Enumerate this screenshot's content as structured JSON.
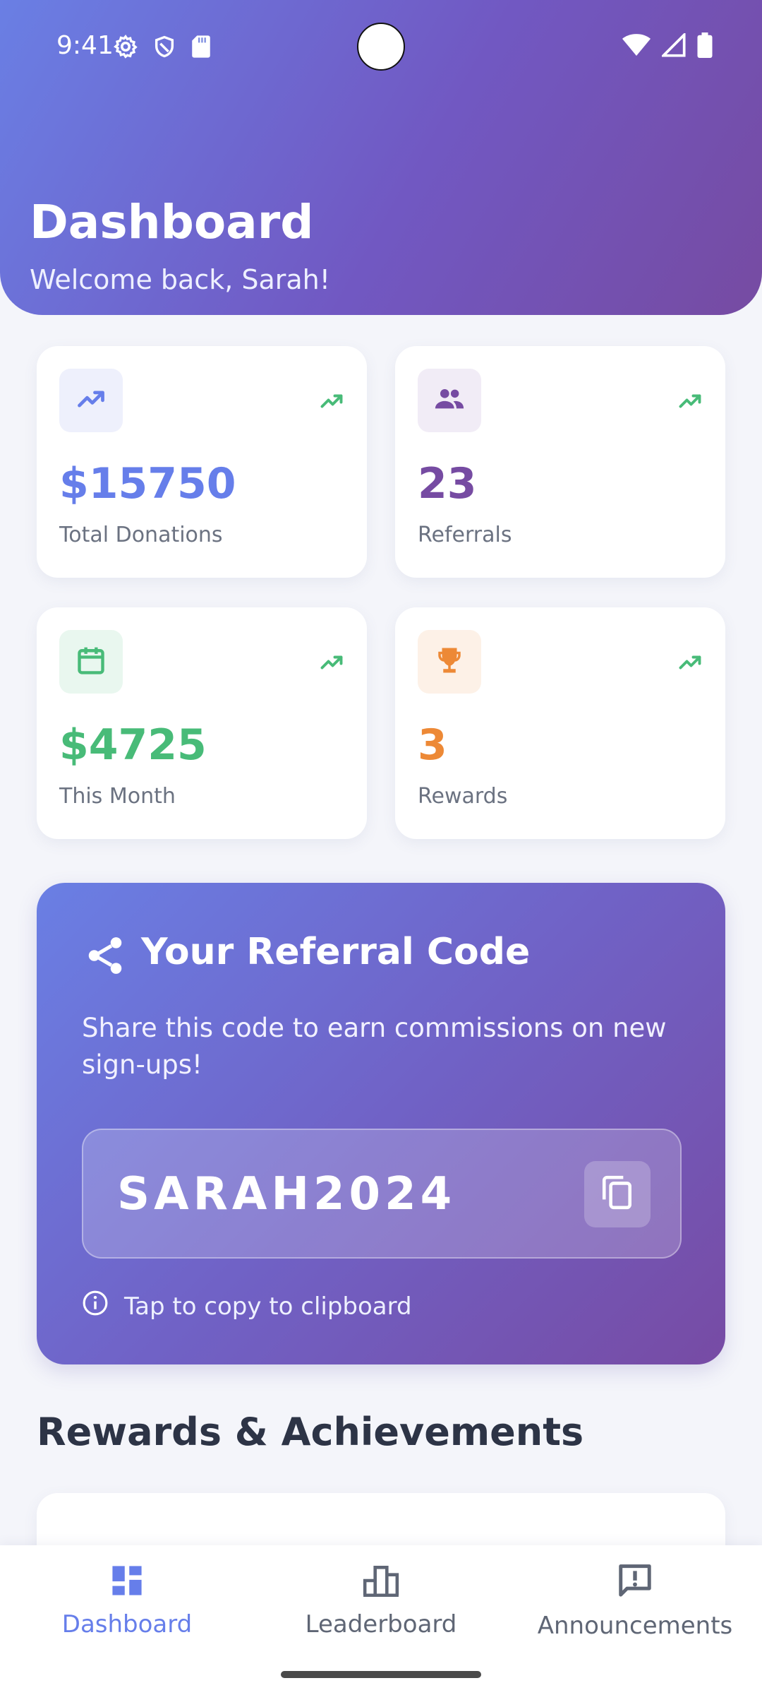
{
  "status_bar": {
    "time": "9:41",
    "icons_left": [
      "gear-icon",
      "shield-icon",
      "sd-card-icon"
    ],
    "icons_right": [
      "wifi-icon",
      "signal-icon",
      "battery-icon"
    ]
  },
  "header": {
    "title": "Dashboard",
    "subtitle": "Welcome back, Sarah!",
    "gradient": [
      "#667eea",
      "#764ba2"
    ]
  },
  "stats": [
    {
      "value": "$15750",
      "label": "Total Donations",
      "icon": "trending-up-icon",
      "color": "#667eea",
      "bg": "#eef0fc"
    },
    {
      "value": "23",
      "label": "Referrals",
      "icon": "people-icon",
      "color": "#764ba2",
      "bg": "#f1ecf6"
    },
    {
      "value": "$4725",
      "label": "This Month",
      "icon": "calendar-icon",
      "color": "#48bb78",
      "bg": "#e9f7ef"
    },
    {
      "value": "3",
      "label": "Rewards",
      "icon": "trophy-icon",
      "color": "#ed8936",
      "bg": "#fdf1e7"
    }
  ],
  "trend_color": "#48bb78",
  "referral": {
    "title": "Your Referral Code",
    "description": "Share this code to earn commissions on new sign-ups!",
    "code": "SARAH2024",
    "hint": "Tap to copy to clipboard"
  },
  "rewards_section": {
    "title": "Rewards & Achievements"
  },
  "bottom_nav": {
    "items": [
      {
        "label": "Dashboard",
        "icon": "dashboard-icon",
        "active": true
      },
      {
        "label": "Leaderboard",
        "icon": "leaderboard-icon",
        "active": false
      },
      {
        "label": "Announcements",
        "icon": "announcement-icon",
        "active": false
      }
    ],
    "active_color": "#667eea"
  }
}
